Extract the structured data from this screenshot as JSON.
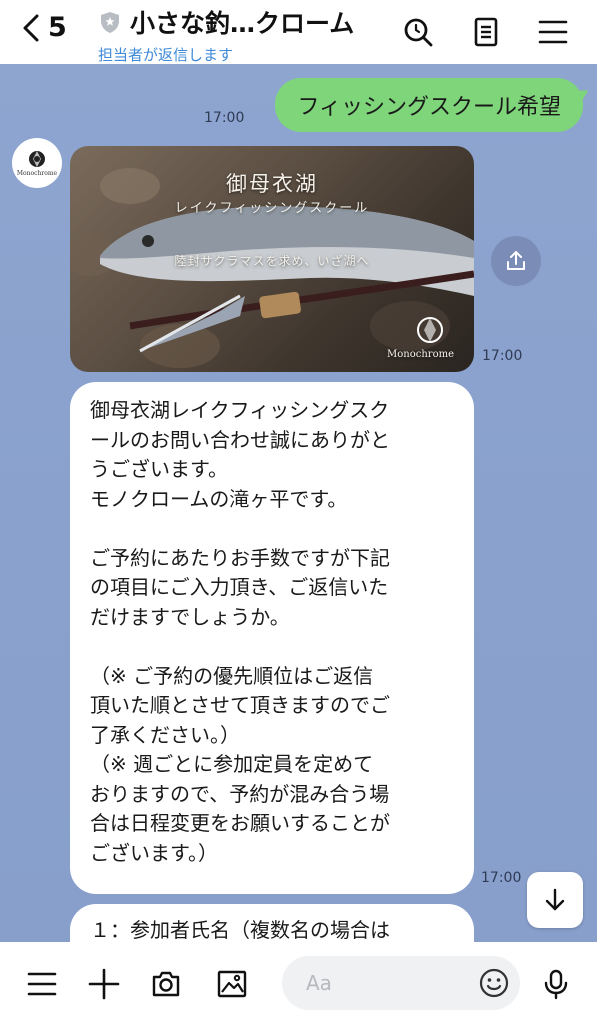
{
  "header": {
    "back_count": "5",
    "title": "小さな釣…クローム",
    "subtitle": "担当者が返信します"
  },
  "chat": {
    "sent_message": "フィッシングスクール希望",
    "sent_time": "17:00",
    "photo_time": "17:00",
    "text_time": "17:00",
    "avatar_label": "Monochrome",
    "photo": {
      "title": "御母衣湖",
      "subtitle": "レイクフィッシングスクール",
      "tagline": "陸封サクラマスを求め、いざ湖へ",
      "brand": "Monochrome"
    },
    "message_lines": [
      "御母衣湖レイクフィッシングスク",
      "ールのお問い合わせ誠にありがと",
      "うございます。",
      "モノクロームの滝ヶ平です。",
      "",
      "ご予約にあたりお手数ですが下記",
      "の項目にご入力頂き、ご返信いた",
      "だけますでしょうか。",
      "",
      "（※ ご予約の優先順位はご返信",
      "頂いた順とさせて頂きますのでご",
      "了承ください。）",
      "（※ 週ごとに参加定員を定めて",
      "おりますので、予約が混み合う場",
      "合は日程変更をお願いすることが",
      "ございます。）"
    ],
    "next_message_partial": "１：参加者氏名（複数名の場合は"
  },
  "footer": {
    "input_placeholder": "Aa"
  },
  "colors": {
    "chat_bg": "#8ca3cf",
    "sent_bubble": "#7ed57a",
    "subtitle": "#3f8ad8"
  },
  "icons": [
    "chevron-left-icon",
    "shield-icon",
    "search-icon",
    "notes-icon",
    "menu-icon",
    "share-icon",
    "arrow-down-icon",
    "menu-icon",
    "plus-icon",
    "camera-icon",
    "image-icon",
    "smile-icon",
    "mic-icon"
  ]
}
